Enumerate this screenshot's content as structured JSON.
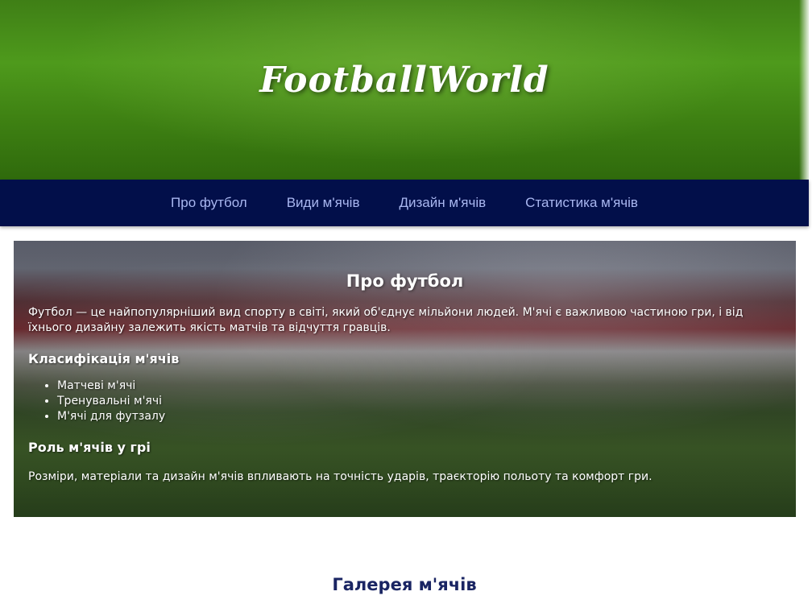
{
  "header": {
    "title": "FootballWorld"
  },
  "nav": {
    "items": [
      {
        "label": "Про футбол"
      },
      {
        "label": "Види м'ячів"
      },
      {
        "label": "Дизайн м'ячів"
      },
      {
        "label": "Статистика м'ячів"
      }
    ]
  },
  "about": {
    "title": "Про футбол",
    "intro": "Футбол — це найпопулярніший вид спорту в світі, який об'єднує мільйони людей. М'ячі є важливою частиною гри, і від їхнього дизайну залежить якість матчів та відчуття гравців.",
    "classification_title": "Класифікація м'ячів",
    "classification_items": [
      "Матчеві м'ячі",
      "Тренувальні м'ячі",
      "М'ячі для футзалу"
    ],
    "role_title": "Роль м'ячів у грі",
    "role_text": "Розміри, матеріали та дизайн м'ячів впливають на точність ударів, траєкторію польоту та комфорт гри."
  },
  "gallery": {
    "title": "Галерея м'ячів"
  },
  "colors": {
    "nav_bg": "#020f4a",
    "nav_link": "#a9b7f0",
    "gallery_title": "#1a2563"
  }
}
